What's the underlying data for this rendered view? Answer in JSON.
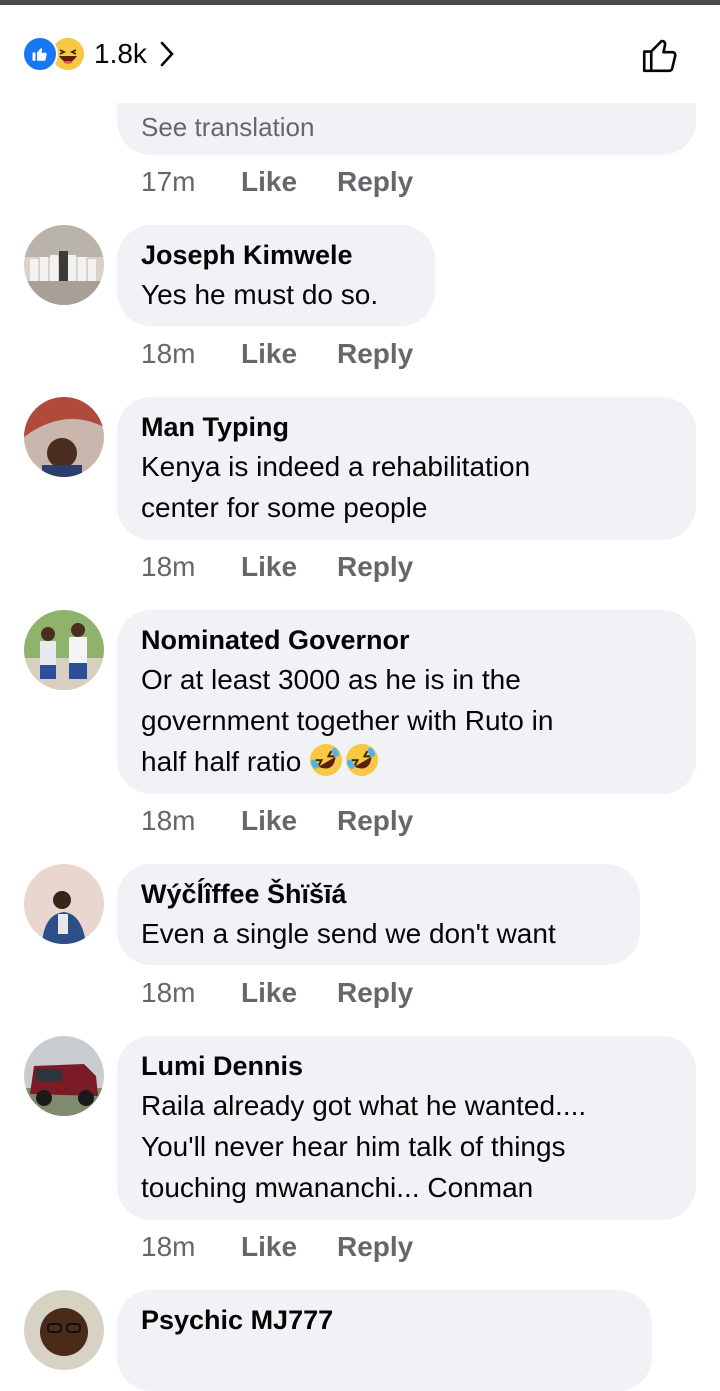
{
  "header": {
    "reaction_count": "1.8k",
    "reaction_icons": [
      "like-reaction-icon",
      "haha-reaction-icon"
    ]
  },
  "colors": {
    "accent": "#1877f2",
    "bubble": "#f0f2f5",
    "meta_text": "#65676b"
  },
  "first_comment": {
    "see_translation": "See translation",
    "time": "17m",
    "like": "Like",
    "reply": "Reply"
  },
  "comments": [
    {
      "author": "Joseph Kimwele",
      "lines": [
        "Yes he must do so."
      ],
      "time": "18m",
      "like": "Like",
      "reply": "Reply"
    },
    {
      "author": "Man Typing",
      "lines": [
        "Kenya is indeed a rehabilitation",
        "center for some people"
      ],
      "time": "18m",
      "like": "Like",
      "reply": "Reply"
    },
    {
      "author": "Nominated Governor",
      "lines": [
        "Or at least 3000 as he is in the",
        "government together with Ruto in",
        "half half ratio"
      ],
      "emoji": "rolling-laughing-icon",
      "time": "18m",
      "like": "Like",
      "reply": "Reply"
    },
    {
      "author": "Wýčĺîffee Šhïšīá",
      "lines": [
        "Even a single send we don't  want"
      ],
      "time": "18m",
      "like": "Like",
      "reply": "Reply"
    },
    {
      "author": "Lumi Dennis",
      "lines": [
        "Raila already got what he wanted....",
        "You'll never hear him talk of things",
        "touching mwananchi... Conman"
      ],
      "time": "18m",
      "like": "Like",
      "reply": "Reply"
    },
    {
      "author": "Psychic MJ777"
    }
  ]
}
